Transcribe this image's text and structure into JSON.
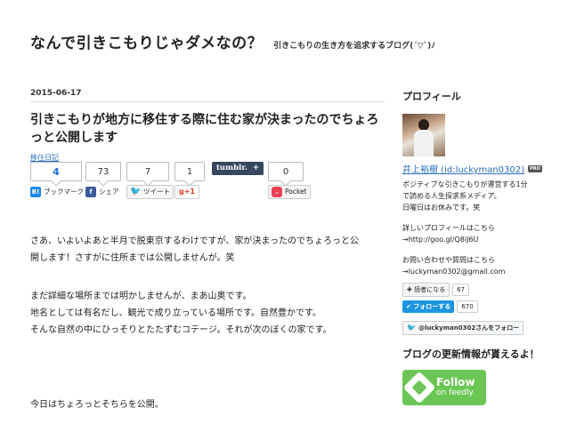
{
  "header": {
    "title": "なんで引きこもりじゃダメなの？",
    "description": "引きこもりの生き方を追求するブログ(´▽`)ﾉ"
  },
  "article": {
    "date": "2015-06-17",
    "title": "引きこもりが地方に移住する際に住む家が決まったのでちょろっと公開します",
    "category": "移住日記",
    "share": {
      "hatena": {
        "count": "4",
        "label": "ブックマーク",
        "icon": "B!"
      },
      "facebook": {
        "count": "73",
        "label": "シェア",
        "icon": "f"
      },
      "twitter": {
        "count": "7",
        "label": "ツイート",
        "icon": "twitter-bird"
      },
      "google": {
        "count": "1",
        "label": "g+1"
      },
      "tumblr": {
        "label": "tumblr.",
        "plus": "+"
      },
      "pocket": {
        "count": "0",
        "label": "Pocket"
      }
    },
    "paragraphs": [
      "さあ、いよいよあと半月で脱東京するわけですが、家が決まったのでちょろっと公",
      "開します！さすがに住所までは公開しませんが。笑",
      "まだ詳細な場所までは明かしませんが、まあ山奥です。",
      "地名としては有名だし、観光で成り立っている場所です。自然豊かです。",
      "そんな自然の中にひっそりとたたずむコテージ。それが次のぼくの家です。",
      "今日はちょろっとそちらを公開。"
    ]
  },
  "sidebar": {
    "profile_heading": "プロフィール",
    "name": "井上裕樹 (id:luckyman0302)",
    "pro_badge": "PRO",
    "bio": [
      "ポジティブな引きこもりが運営する1分",
      "で読める人生探求系メディア。",
      "日曜日はお休みです。笑"
    ],
    "details": [
      "詳しいプロフィールはこちら",
      "→http://goo.gl/Q8iJ6U"
    ],
    "contact": [
      "お問い合わせや質問はこちら",
      "→luckyman0302@gmail.com"
    ],
    "reader_button": "✚ 読者になる",
    "reader_count": "67",
    "follow_button": "✔ フォローする",
    "follow_count": "670",
    "twitter_follow": "@luckyman0302さんをフォロー",
    "feed_heading": "ブログの更新情報が貰えるよ！",
    "feedly": {
      "big": "Follow",
      "small": "on feedly"
    },
    "colors": {
      "twitter": "#1b95e0",
      "feedly": "#6cc655",
      "link": "#2a6fbf"
    }
  }
}
